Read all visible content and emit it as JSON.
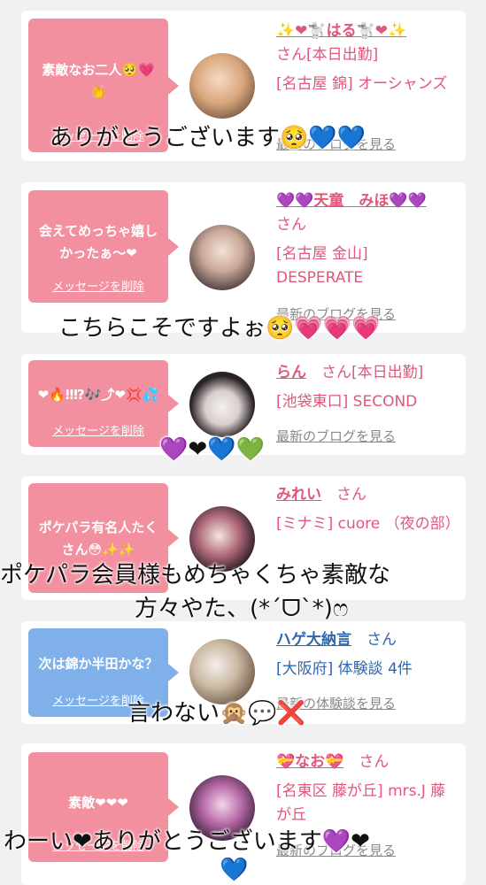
{
  "delete_label": "メッセージを削除",
  "cards": [
    {
      "message": "素敵なお二人🥺💗👏",
      "name": "✨❤🐩はる🐩❤✨",
      "san": "さん[本日出勤]",
      "shop": "[名古屋 錦] オーシャンズ",
      "blog": "最新のブログを見る",
      "overlay": "ありがとうございます🥺💙💙"
    },
    {
      "message": "会えてめっちゃ嬉しかったぁ〜❤",
      "name": "💜💜天童　みほ💜💜",
      "san": "さん",
      "shop": "[名古屋 金山] DESPERATE",
      "blog": "最新のブログを見る",
      "overlay": "こちらこそですよぉ🥺💗💗💗"
    },
    {
      "message": "❤🔥‼⁉🎶⤴❤💢💦",
      "name": "らん",
      "san": "さん[本日出勤]",
      "shop": "[池袋東口] SECOND",
      "blog": "最新のブログを見る",
      "overlay": "💜❤💙💚"
    },
    {
      "message": "ポケパラ有名人たくさん😳✨✨",
      "name": "みれい",
      "san": "さん",
      "shop": "[ミナミ] cuore （夜の部）",
      "blog": "最新のブログを見る",
      "overlay": "ポケパラ会員様もめちゃくちゃ素敵な",
      "overlay2": "方々やた、(*´ᗜ`*)ෆ"
    },
    {
      "message": "次は錦か半田かな？",
      "name": "ハゲ大納言",
      "san": "さん",
      "shop": "[大阪府] 体験談 4件",
      "blog": "最新の体験談を見る",
      "overlay": "言わない🙊💬❌"
    },
    {
      "message": "素敵❤❤❤",
      "name": "💝なお💝",
      "san": "さん",
      "shop": "[名東区 藤が丘] mrs.J 藤が丘",
      "blog": "最新のブログを見る",
      "overlay": "わーい❤ありがとうございます💜❤",
      "overlay2": "💙"
    }
  ],
  "colors": {
    "bubble_pink": "#f2909f",
    "bubble_blue": "#7fb0ea",
    "name_pink": "#e0577a",
    "name_blue": "#2c67b0"
  }
}
